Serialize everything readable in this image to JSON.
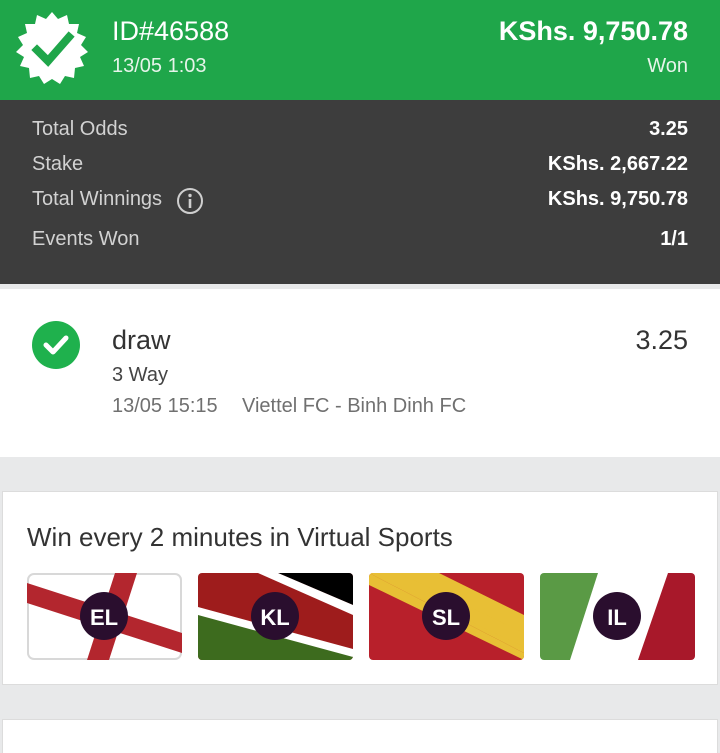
{
  "bet": {
    "id": "ID#46588",
    "date": "13/05 1:03",
    "amount": "KShs. 9,750.78",
    "status": "Won"
  },
  "summary": {
    "rows": [
      {
        "label": "Total Odds",
        "value": "3.25"
      },
      {
        "label": "Stake",
        "value": "KShs. 2,667.22"
      },
      {
        "label": "Total Winnings",
        "value": "KShs. 9,750.78"
      },
      {
        "label": "Events Won",
        "value": "1/1"
      }
    ]
  },
  "event": {
    "pick": "draw",
    "market": "3 Way",
    "time": "13/05 15:15",
    "teams": "Viettel FC - Binh Dinh FC",
    "odds": "3.25"
  },
  "virtual": {
    "title": "Win every 2 minutes in Virtual Sports",
    "leagues": [
      {
        "code": "EL",
        "icon": "england-flag"
      },
      {
        "code": "KL",
        "icon": "kenya-flag"
      },
      {
        "code": "SL",
        "icon": "spain-flag"
      },
      {
        "code": "IL",
        "icon": "italy-flag"
      }
    ]
  },
  "next_section": {
    "title": ""
  },
  "colors": {
    "header_green": "#1fa64a",
    "summary_dark": "#3d3d3d",
    "badge_dark": "#2a0e2e"
  }
}
